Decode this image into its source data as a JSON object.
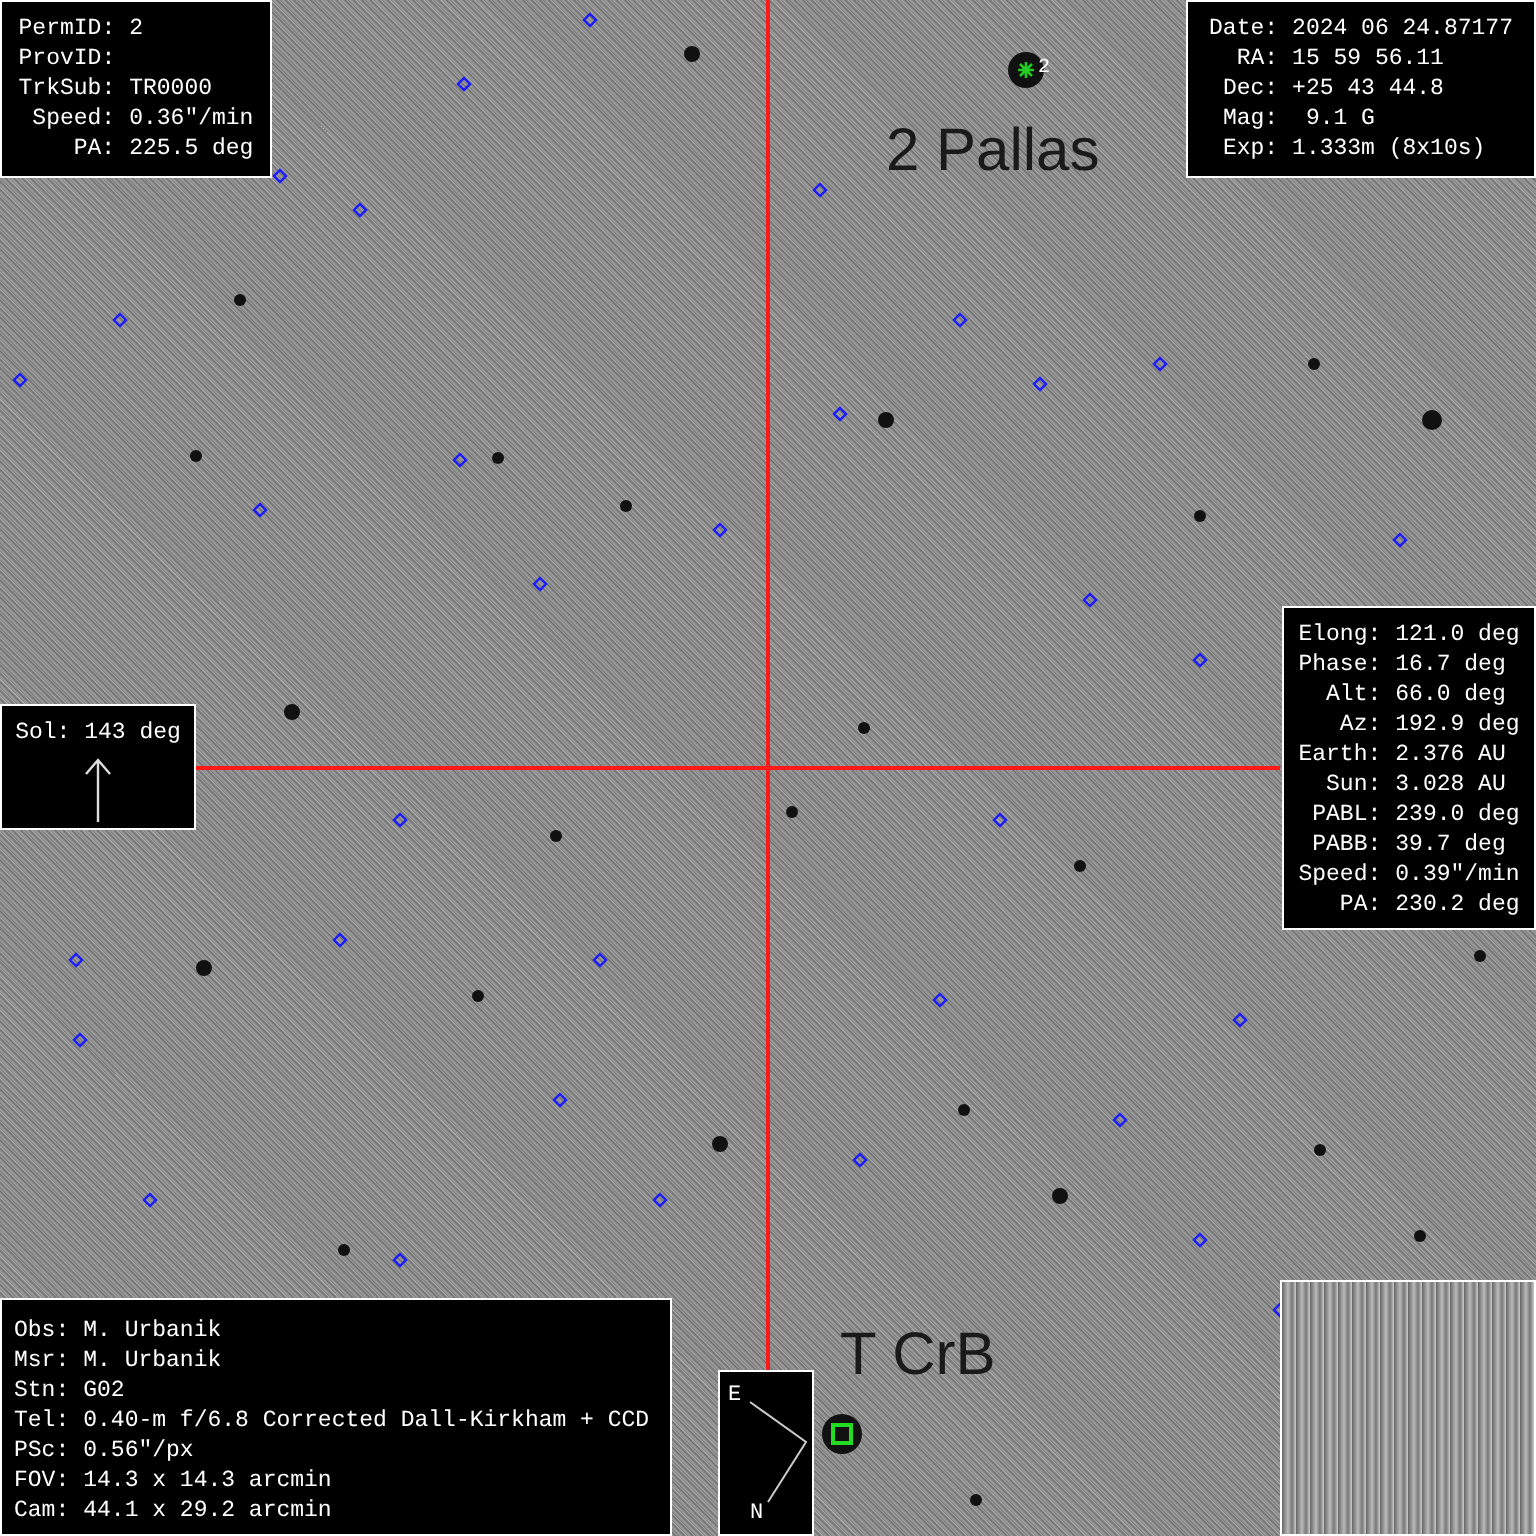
{
  "target_panel": {
    "rows": [
      {
        "label": "PermID:",
        "value": "2"
      },
      {
        "label": "ProvID:"
      },
      {
        "label": "TrkSub:",
        "value": "TR0000"
      },
      {
        "label": "Speed:",
        "value": "0.36\"/min"
      },
      {
        "label": "PA:",
        "value": "225.5 deg"
      }
    ]
  },
  "observation_panel": {
    "rows": [
      {
        "label": "Date:",
        "value": "2024 06 24.87177"
      },
      {
        "label": "RA:",
        "value": "15 59 56.11"
      },
      {
        "label": "Dec:",
        "value": "+25 43 44.8"
      },
      {
        "label": "Mag:",
        "value": " 9.1 G"
      },
      {
        "label": "Exp:",
        "value": "1.333m (8x10s)"
      }
    ]
  },
  "geometry_panel": {
    "rows": [
      {
        "label": "Elong:",
        "value": "121.0 deg"
      },
      {
        "label": "Phase:",
        "value": "16.7 deg"
      },
      {
        "label": "Alt:",
        "value": "66.0 deg"
      },
      {
        "label": "Az:",
        "value": "192.9 deg"
      },
      {
        "label": "Earth:",
        "value": "2.376 AU"
      },
      {
        "label": "Sun:",
        "value": "3.028 AU"
      },
      {
        "label": "PABL:",
        "value": "239.0 deg"
      },
      {
        "label": "PABB:",
        "value": "39.7 deg"
      },
      {
        "label": "Speed:",
        "value": "0.39\"/min"
      },
      {
        "label": "PA:",
        "value": "230.2 deg"
      }
    ]
  },
  "sun_indicator": {
    "text": "Sol: 143 deg"
  },
  "station_panel": {
    "rows": [
      {
        "label": "Obs:",
        "value": "M. Urbanik"
      },
      {
        "label": "Msr:",
        "value": "M. Urbanik"
      },
      {
        "label": "Stn:",
        "value": "G02"
      },
      {
        "label": "Tel:",
        "value": "0.40-m f/6.8 Corrected Dall-Kirkham + CCD"
      },
      {
        "label": "PSc:",
        "value": "0.56\"/px"
      },
      {
        "label": "FOV:",
        "value": "14.3 x 14.3 arcmin"
      },
      {
        "label": "Cam:",
        "value": "44.1 x 29.2 arcmin"
      }
    ]
  },
  "object_labels": [
    {
      "text": "2 Pallas"
    },
    {
      "text": "T CrB"
    }
  ],
  "target_marker": {
    "label": "2"
  },
  "compass": {
    "east": "E",
    "north": "N"
  }
}
